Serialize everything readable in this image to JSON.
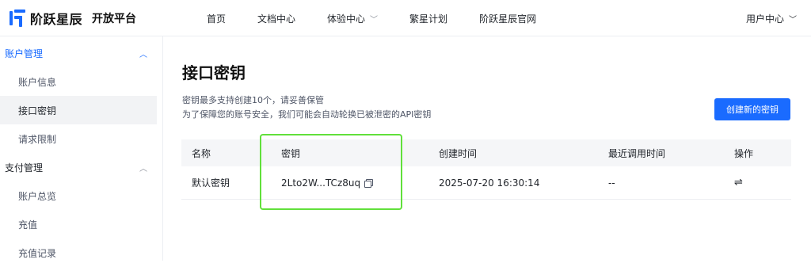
{
  "header": {
    "brand": "阶跃星辰",
    "platform": "开放平台",
    "nav": [
      {
        "label": "首页"
      },
      {
        "label": "文档中心"
      },
      {
        "label": "体验中心"
      },
      {
        "label": "繁星计划"
      },
      {
        "label": "阶跃星辰官网"
      }
    ],
    "user_center": "用户中心"
  },
  "sidebar": {
    "groups": [
      {
        "label": "账户管理",
        "items": [
          {
            "label": "账户信息"
          },
          {
            "label": "接口密钥"
          },
          {
            "label": "请求限制"
          }
        ]
      },
      {
        "label": "支付管理",
        "items": [
          {
            "label": "账户总览"
          },
          {
            "label": "充值"
          },
          {
            "label": "充值记录"
          }
        ]
      }
    ]
  },
  "main": {
    "title": "接口密钥",
    "desc_line1": "密钥最多支持创建10个，请妥善保管",
    "desc_line2": "为了保障您的账号安全，我们可能会自动轮换已被泄密的API密钥",
    "create_button": "创建新的密钥",
    "table": {
      "columns": [
        "名称",
        "密钥",
        "创建时间",
        "最近调用时间",
        "操作"
      ],
      "rows": [
        {
          "name": "默认密钥",
          "key": "2Lto2W...TCz8uq",
          "created": "2025-07-20 16:30:14",
          "last_used": "--",
          "action_icon": "swap-icon"
        }
      ]
    }
  },
  "colors": {
    "accent": "#1a6bff",
    "highlight": "#61e03b"
  }
}
